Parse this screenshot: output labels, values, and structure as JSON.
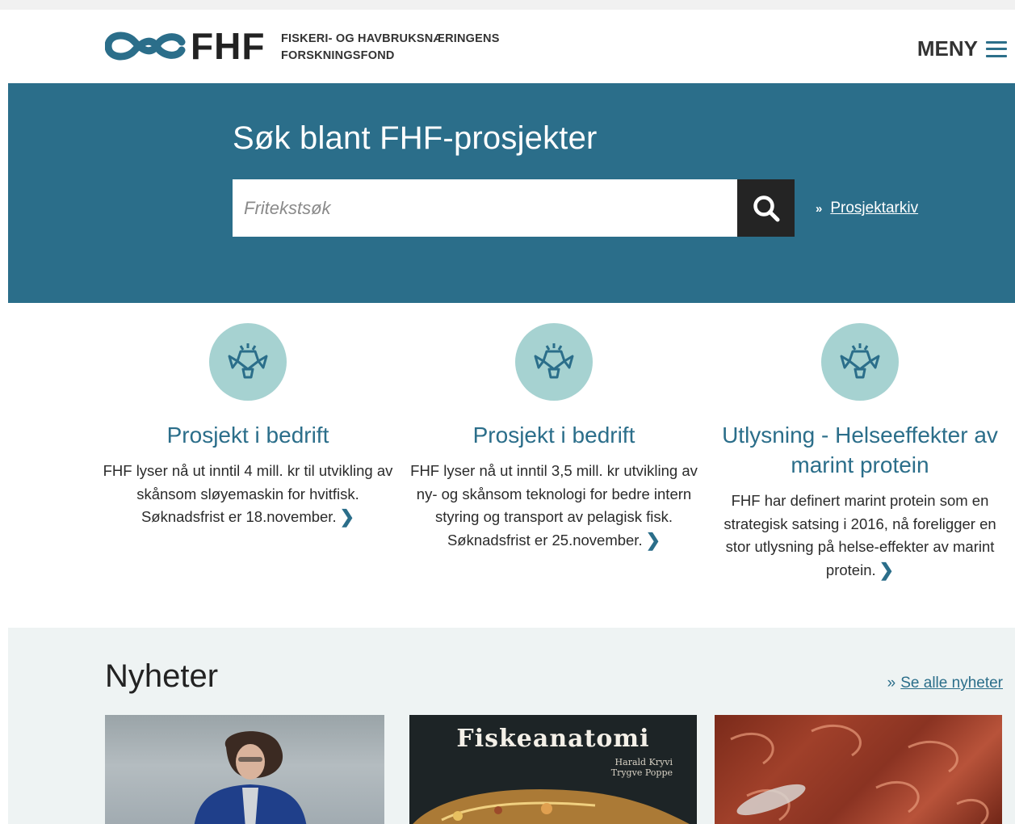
{
  "header": {
    "logo_text": "FHF",
    "tagline_line1": "FISKERI- OG HAVBRUKSNÆRINGENS",
    "tagline_line2": "FORSKNINGSFOND",
    "menu_label": "MENY"
  },
  "hero": {
    "title": "Søk blant FHF-prosjekter",
    "search_placeholder": "Fritekstsøk",
    "archive_link": "Prosjektarkiv"
  },
  "features": [
    {
      "title": "Prosjekt i bedrift",
      "text": "FHF lyser nå ut inntil 4 mill. kr til utvikling av skånsom sløyemaskin for hvitfisk. Søknadsfrist er 18.november."
    },
    {
      "title": "Prosjekt i bedrift",
      "text": "FHF lyser nå ut inntil 3,5 mill. kr utvikling av ny- og skånsom teknologi for bedre intern styring og transport av pelagisk fisk. Søknadsfrist er 25.november."
    },
    {
      "title": "Utlysning - Helseeffekter av marint protein",
      "text": "FHF har definert marint protein som en strategisk satsing i 2016, nå foreligger en stor utlysning på helse-effekter av marint protein."
    }
  ],
  "news": {
    "title": "Nyheter",
    "see_all": "Se alle nyheter",
    "book": {
      "title": "Fiskeanatomi",
      "author1": "Harald Kryvi",
      "author2": "Trygve Poppe"
    }
  },
  "colors": {
    "brand_blue": "#2b6e8a",
    "icon_bg": "#a6d2d1",
    "search_button": "#242424"
  }
}
